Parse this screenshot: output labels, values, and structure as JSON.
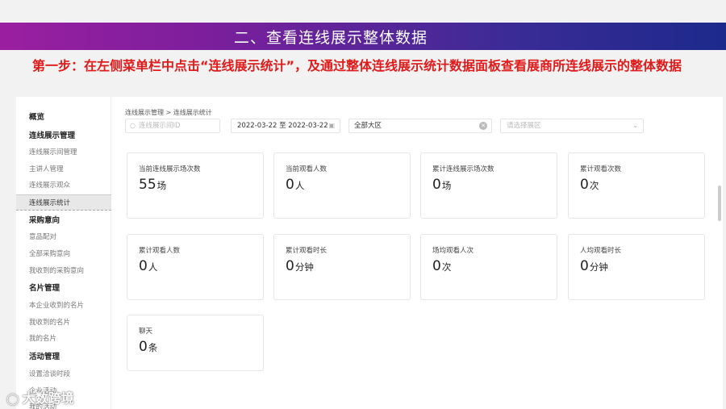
{
  "banner": {
    "title": "二、查看连线展示整体数据"
  },
  "instruction": {
    "text": "第一步：在左侧菜单栏中点击“连线展示统计”，及通过整体连线展示统计数据面板查看展商所连线展示的整体数据"
  },
  "sidebar": {
    "items": [
      {
        "label": "概览",
        "type": "group"
      },
      {
        "label": "连线展示管理",
        "type": "group"
      },
      {
        "label": "连线展示间管理",
        "type": "item"
      },
      {
        "label": "主讲人管理",
        "type": "item"
      },
      {
        "label": "连线展示观众",
        "type": "item"
      },
      {
        "label": "连线展示统计",
        "type": "item",
        "active": true
      },
      {
        "label": "采购意向",
        "type": "group"
      },
      {
        "label": "意品配对",
        "type": "item"
      },
      {
        "label": "全部采购意向",
        "type": "item"
      },
      {
        "label": "我收到的采购意向",
        "type": "item"
      },
      {
        "label": "名片管理",
        "type": "group"
      },
      {
        "label": "本企业收到的名片",
        "type": "item"
      },
      {
        "label": "我收到的名片",
        "type": "item"
      },
      {
        "label": "我的名片",
        "type": "item"
      },
      {
        "label": "活动管理",
        "type": "group"
      },
      {
        "label": "设置洽谈时段",
        "type": "item"
      },
      {
        "label": "企业活动",
        "type": "item"
      },
      {
        "label": "我的活动",
        "type": "item"
      }
    ]
  },
  "breadcrumb": "连线展示管理 > 连线展示统计",
  "filters": {
    "search_placeholder": "连线展示间ID",
    "date_range": "2022-03-22 至 2022-03-22",
    "region": "全部大区",
    "exhibit_placeholder": "请选择展区"
  },
  "stats": [
    {
      "label": "当前连线展示场次数",
      "value": "55",
      "unit": "场"
    },
    {
      "label": "当前观看人数",
      "value": "0",
      "unit": "人"
    },
    {
      "label": "累计连线展示场次数",
      "value": "0",
      "unit": "场"
    },
    {
      "label": "累计观看次数",
      "value": "0",
      "unit": "次"
    },
    {
      "label": "累计观看人数",
      "value": "0",
      "unit": "人"
    },
    {
      "label": "累计观看时长",
      "value": "0",
      "unit": "分钟"
    },
    {
      "label": "场均观看人次",
      "value": "0",
      "unit": "次"
    },
    {
      "label": "人均观看时长",
      "value": "0",
      "unit": "分钟"
    },
    {
      "label": "聊天",
      "value": "0",
      "unit": "条"
    }
  ],
  "watermark": {
    "text": "大数跨境"
  }
}
